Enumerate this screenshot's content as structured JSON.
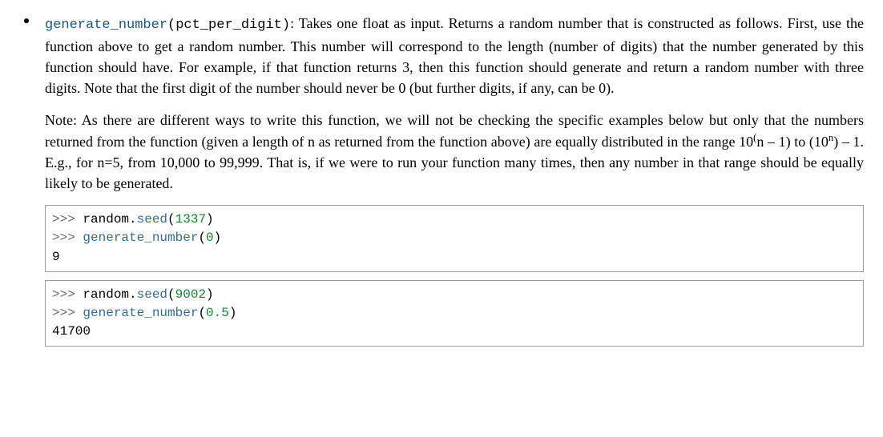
{
  "item": {
    "func_name": "generate_number",
    "param_name": "pct_per_digit",
    "desc_part1": "Takes one float as input.  Returns a random number that is constructed as follows.  First, use the function above to get a random number.  This number will correspond to the length (number of digits) that the number generated by this function should have.  For example, if that function returns 3, then this function should generate and return a random number with three digits.  Note that the first digit of the number should never be 0 (but further digits, if any, can be 0).",
    "note_part1": "Note: As there are different ways to write this function, we will not be checking the specific examples below but only that the numbers returned from the function (given a length of n as returned from the function above) are equally distributed in the range 10",
    "note_exp1_open": "(",
    "note_exp1_inner": "n – 1)",
    "note_mid": " to (10",
    "note_exp2": "n",
    "note_part2": ") – 1.  E.g., for n=5, from 10,000 to 99,999.  That is, if we were to run your function many times, then any number in that range should be equally likely to be generated."
  },
  "code1": {
    "line1_prompt": ">>> ",
    "line1_code_a": "random.",
    "line1_code_b": "seed",
    "line1_code_c": "(",
    "line1_num": "1337",
    "line1_code_d": ")",
    "line2_prompt": ">>> ",
    "line2_call": "generate_number",
    "line2_open": "(",
    "line2_arg": "0",
    "line2_close": ")",
    "line3_out": "9"
  },
  "code2": {
    "line1_prompt": ">>> ",
    "line1_code_a": "random.",
    "line1_code_b": "seed",
    "line1_code_c": "(",
    "line1_num": "9002",
    "line1_code_d": ")",
    "line2_prompt": ">>> ",
    "line2_call": "generate_number",
    "line2_open": "(",
    "line2_arg": "0.5",
    "line2_close": ")",
    "line3_out": "41700"
  }
}
